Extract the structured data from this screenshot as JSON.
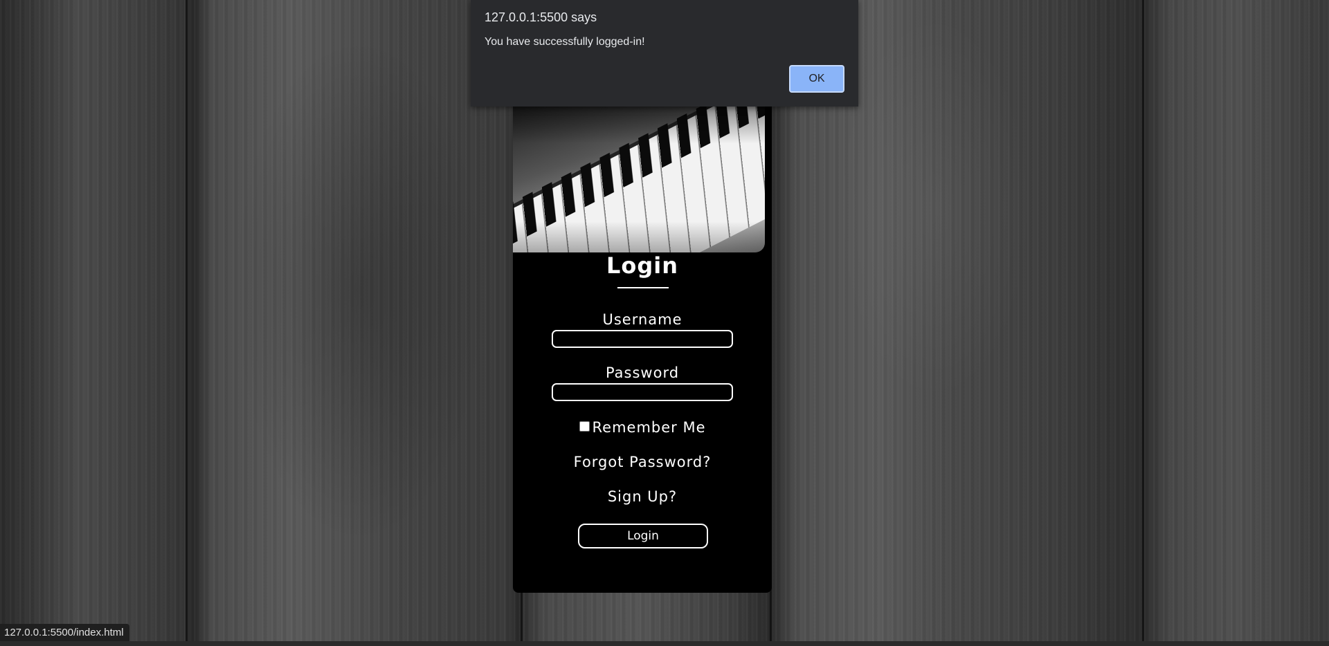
{
  "dialog": {
    "origin": "127.0.0.1:5500 says",
    "message": "You have successfully logged-in!",
    "ok_label": "OK"
  },
  "login_card": {
    "title": "Login",
    "username_label": "Username",
    "username_value": "",
    "password_label": "Password",
    "password_value": "",
    "remember_label": "Remember Me",
    "remember_checked": false,
    "forgot_link": "Forgot Password?",
    "signup_link": "Sign Up?",
    "submit_label": "Login"
  },
  "status_bar": {
    "url": "127.0.0.1:5500/index.html"
  },
  "colors": {
    "dialog_bg": "#292a2d",
    "ok_button": "#8ab4f8",
    "card_bg": "#000000",
    "text": "#ffffff"
  }
}
